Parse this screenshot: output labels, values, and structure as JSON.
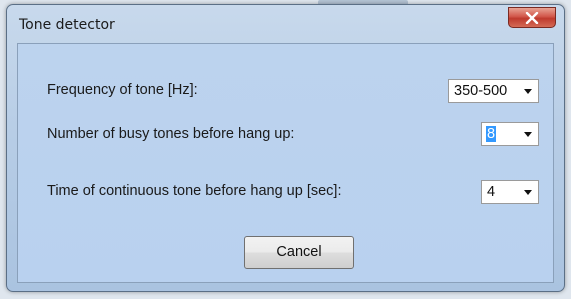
{
  "window": {
    "title": "Tone detector"
  },
  "colors": {
    "title_bar": "#c8d9ec",
    "client_area": "#b9d1ef",
    "close_button": "#c8463a",
    "selection": "#3399ff"
  },
  "icons": {
    "close": "close-icon",
    "dropdown": "chevron-down-icon"
  },
  "fields": {
    "frequency": {
      "label": "Frequency of tone [Hz]:",
      "value": "350-500"
    },
    "busy_tones": {
      "label": "Number of busy tones before hang up:",
      "value": "8"
    },
    "continuous_time": {
      "label": "Time of continuous tone before hang  up [sec]:",
      "value": "4"
    }
  },
  "buttons": {
    "cancel": "Cancel"
  }
}
